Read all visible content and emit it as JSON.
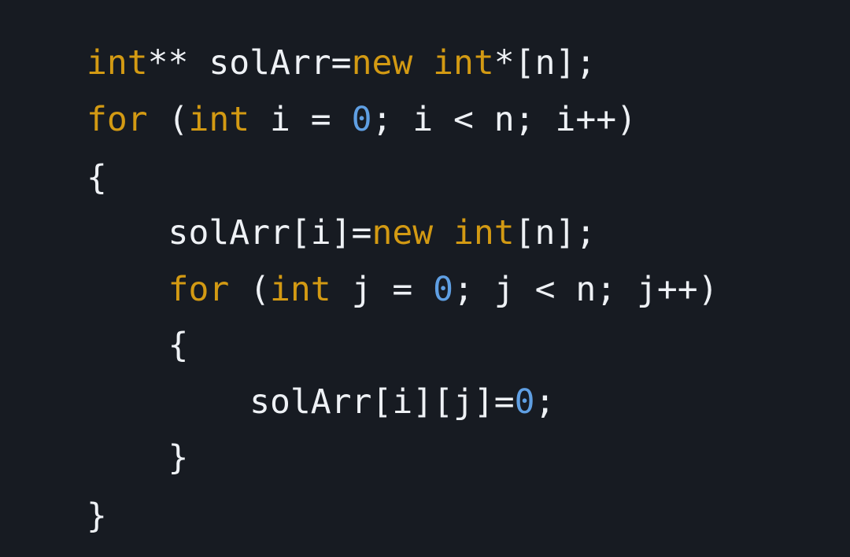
{
  "colors": {
    "background": "#171b22",
    "keyword": "#d39a13",
    "number": "#5f9fe3",
    "plain": "#eef1f5"
  },
  "code": {
    "lines": [
      {
        "tokens": [
          {
            "text": "int",
            "kind": "keyword"
          },
          {
            "text": "** solArr=",
            "kind": "plain"
          },
          {
            "text": "new",
            "kind": "keyword"
          },
          {
            "text": " ",
            "kind": "plain"
          },
          {
            "text": "int",
            "kind": "keyword"
          },
          {
            "text": "*[n];",
            "kind": "plain"
          }
        ]
      },
      {
        "tokens": [
          {
            "text": "for",
            "kind": "keyword"
          },
          {
            "text": " (",
            "kind": "plain"
          },
          {
            "text": "int",
            "kind": "keyword"
          },
          {
            "text": " i = ",
            "kind": "plain"
          },
          {
            "text": "0",
            "kind": "number"
          },
          {
            "text": "; i < n; i++)",
            "kind": "plain"
          }
        ]
      },
      {
        "tokens": [
          {
            "text": "{",
            "kind": "plain"
          }
        ]
      },
      {
        "tokens": [
          {
            "text": "    solArr[i]=",
            "kind": "plain"
          },
          {
            "text": "new",
            "kind": "keyword"
          },
          {
            "text": " ",
            "kind": "plain"
          },
          {
            "text": "int",
            "kind": "keyword"
          },
          {
            "text": "[n];",
            "kind": "plain"
          }
        ]
      },
      {
        "tokens": [
          {
            "text": "    ",
            "kind": "plain"
          },
          {
            "text": "for",
            "kind": "keyword"
          },
          {
            "text": " (",
            "kind": "plain"
          },
          {
            "text": "int",
            "kind": "keyword"
          },
          {
            "text": " j = ",
            "kind": "plain"
          },
          {
            "text": "0",
            "kind": "number"
          },
          {
            "text": "; j < n; j++)",
            "kind": "plain"
          }
        ]
      },
      {
        "tokens": [
          {
            "text": "    {",
            "kind": "plain"
          }
        ]
      },
      {
        "tokens": [
          {
            "text": "        solArr[i][j]=",
            "kind": "plain"
          },
          {
            "text": "0",
            "kind": "number"
          },
          {
            "text": ";",
            "kind": "plain"
          }
        ]
      },
      {
        "tokens": [
          {
            "text": "    }",
            "kind": "plain"
          }
        ]
      },
      {
        "tokens": [
          {
            "text": "}",
            "kind": "plain"
          }
        ]
      }
    ]
  }
}
